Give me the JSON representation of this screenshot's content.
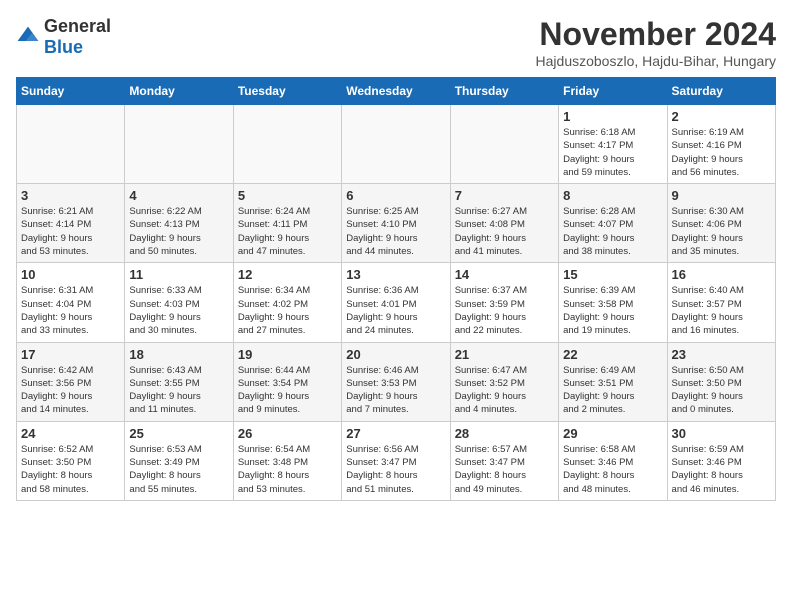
{
  "header": {
    "logo_general": "General",
    "logo_blue": "Blue",
    "title": "November 2024",
    "subtitle": "Hajduszoboszlo, Hajdu-Bihar, Hungary"
  },
  "days_of_week": [
    "Sunday",
    "Monday",
    "Tuesday",
    "Wednesday",
    "Thursday",
    "Friday",
    "Saturday"
  ],
  "weeks": [
    {
      "cells": [
        {
          "day": "",
          "info": ""
        },
        {
          "day": "",
          "info": ""
        },
        {
          "day": "",
          "info": ""
        },
        {
          "day": "",
          "info": ""
        },
        {
          "day": "",
          "info": ""
        },
        {
          "day": "1",
          "info": "Sunrise: 6:18 AM\nSunset: 4:17 PM\nDaylight: 9 hours\nand 59 minutes."
        },
        {
          "day": "2",
          "info": "Sunrise: 6:19 AM\nSunset: 4:16 PM\nDaylight: 9 hours\nand 56 minutes."
        }
      ]
    },
    {
      "cells": [
        {
          "day": "3",
          "info": "Sunrise: 6:21 AM\nSunset: 4:14 PM\nDaylight: 9 hours\nand 53 minutes."
        },
        {
          "day": "4",
          "info": "Sunrise: 6:22 AM\nSunset: 4:13 PM\nDaylight: 9 hours\nand 50 minutes."
        },
        {
          "day": "5",
          "info": "Sunrise: 6:24 AM\nSunset: 4:11 PM\nDaylight: 9 hours\nand 47 minutes."
        },
        {
          "day": "6",
          "info": "Sunrise: 6:25 AM\nSunset: 4:10 PM\nDaylight: 9 hours\nand 44 minutes."
        },
        {
          "day": "7",
          "info": "Sunrise: 6:27 AM\nSunset: 4:08 PM\nDaylight: 9 hours\nand 41 minutes."
        },
        {
          "day": "8",
          "info": "Sunrise: 6:28 AM\nSunset: 4:07 PM\nDaylight: 9 hours\nand 38 minutes."
        },
        {
          "day": "9",
          "info": "Sunrise: 6:30 AM\nSunset: 4:06 PM\nDaylight: 9 hours\nand 35 minutes."
        }
      ]
    },
    {
      "cells": [
        {
          "day": "10",
          "info": "Sunrise: 6:31 AM\nSunset: 4:04 PM\nDaylight: 9 hours\nand 33 minutes."
        },
        {
          "day": "11",
          "info": "Sunrise: 6:33 AM\nSunset: 4:03 PM\nDaylight: 9 hours\nand 30 minutes."
        },
        {
          "day": "12",
          "info": "Sunrise: 6:34 AM\nSunset: 4:02 PM\nDaylight: 9 hours\nand 27 minutes."
        },
        {
          "day": "13",
          "info": "Sunrise: 6:36 AM\nSunset: 4:01 PM\nDaylight: 9 hours\nand 24 minutes."
        },
        {
          "day": "14",
          "info": "Sunrise: 6:37 AM\nSunset: 3:59 PM\nDaylight: 9 hours\nand 22 minutes."
        },
        {
          "day": "15",
          "info": "Sunrise: 6:39 AM\nSunset: 3:58 PM\nDaylight: 9 hours\nand 19 minutes."
        },
        {
          "day": "16",
          "info": "Sunrise: 6:40 AM\nSunset: 3:57 PM\nDaylight: 9 hours\nand 16 minutes."
        }
      ]
    },
    {
      "cells": [
        {
          "day": "17",
          "info": "Sunrise: 6:42 AM\nSunset: 3:56 PM\nDaylight: 9 hours\nand 14 minutes."
        },
        {
          "day": "18",
          "info": "Sunrise: 6:43 AM\nSunset: 3:55 PM\nDaylight: 9 hours\nand 11 minutes."
        },
        {
          "day": "19",
          "info": "Sunrise: 6:44 AM\nSunset: 3:54 PM\nDaylight: 9 hours\nand 9 minutes."
        },
        {
          "day": "20",
          "info": "Sunrise: 6:46 AM\nSunset: 3:53 PM\nDaylight: 9 hours\nand 7 minutes."
        },
        {
          "day": "21",
          "info": "Sunrise: 6:47 AM\nSunset: 3:52 PM\nDaylight: 9 hours\nand 4 minutes."
        },
        {
          "day": "22",
          "info": "Sunrise: 6:49 AM\nSunset: 3:51 PM\nDaylight: 9 hours\nand 2 minutes."
        },
        {
          "day": "23",
          "info": "Sunrise: 6:50 AM\nSunset: 3:50 PM\nDaylight: 9 hours\nand 0 minutes."
        }
      ]
    },
    {
      "cells": [
        {
          "day": "24",
          "info": "Sunrise: 6:52 AM\nSunset: 3:50 PM\nDaylight: 8 hours\nand 58 minutes."
        },
        {
          "day": "25",
          "info": "Sunrise: 6:53 AM\nSunset: 3:49 PM\nDaylight: 8 hours\nand 55 minutes."
        },
        {
          "day": "26",
          "info": "Sunrise: 6:54 AM\nSunset: 3:48 PM\nDaylight: 8 hours\nand 53 minutes."
        },
        {
          "day": "27",
          "info": "Sunrise: 6:56 AM\nSunset: 3:47 PM\nDaylight: 8 hours\nand 51 minutes."
        },
        {
          "day": "28",
          "info": "Sunrise: 6:57 AM\nSunset: 3:47 PM\nDaylight: 8 hours\nand 49 minutes."
        },
        {
          "day": "29",
          "info": "Sunrise: 6:58 AM\nSunset: 3:46 PM\nDaylight: 8 hours\nand 48 minutes."
        },
        {
          "day": "30",
          "info": "Sunrise: 6:59 AM\nSunset: 3:46 PM\nDaylight: 8 hours\nand 46 minutes."
        }
      ]
    }
  ]
}
